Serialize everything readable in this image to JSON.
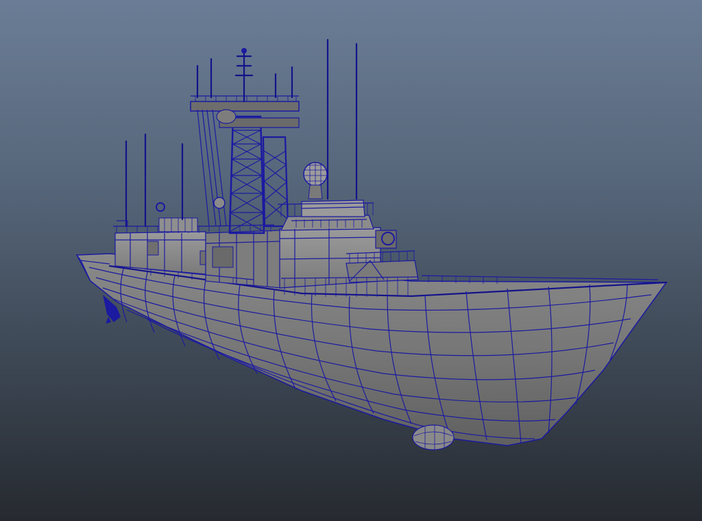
{
  "viewport": {
    "background_top": "#6b7d96",
    "background_bottom": "#262a30",
    "wire_color": "#1b1aa0",
    "surface_light": "#8d8d8d",
    "surface_mid": "#777777",
    "surface_dark": "#5f5f5f"
  },
  "model": {
    "display_mode": "shaded-with-wireframe",
    "parts": [
      "hull",
      "superstructure",
      "lattice-mast",
      "antenna",
      "radar-dome",
      "railing",
      "sonar-dome",
      "propeller"
    ]
  }
}
